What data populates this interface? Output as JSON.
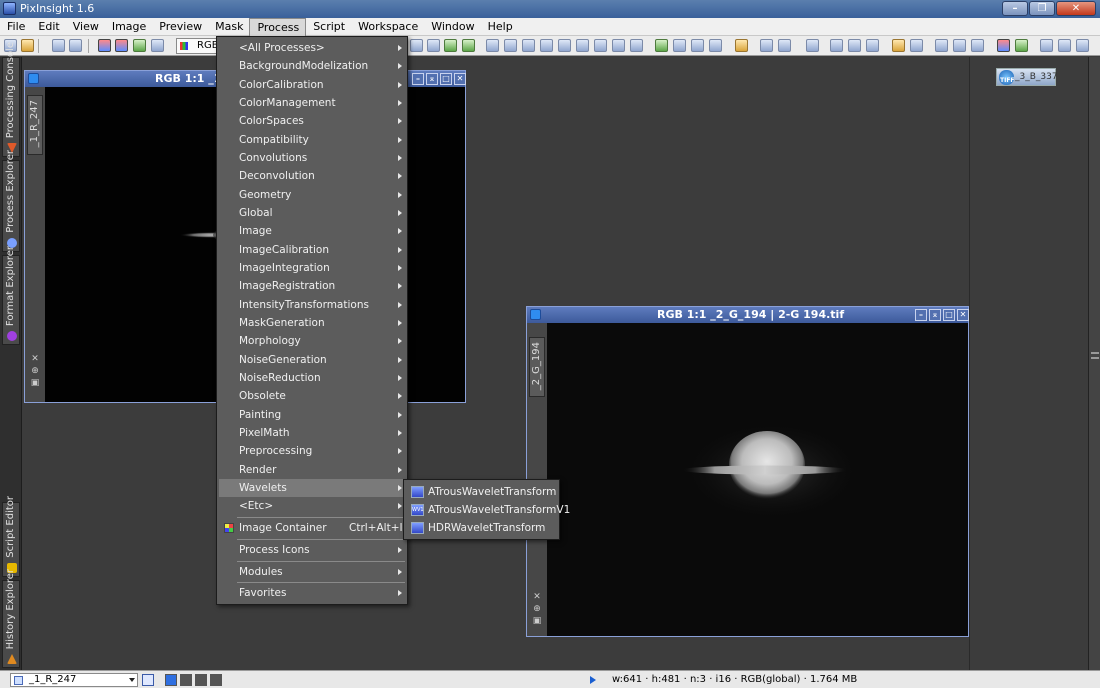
{
  "window": {
    "title": "PixInsight 1.6"
  },
  "menubar": [
    "File",
    "Edit",
    "View",
    "Image",
    "Preview",
    "Mask",
    "Process",
    "Script",
    "Workspace",
    "Window",
    "Help"
  ],
  "toolbar": {
    "rgb_label": "RGB"
  },
  "left_dock": [
    {
      "label": "Processing Console",
      "icon": "arrow-down-icon",
      "color": "#e05a2a"
    },
    {
      "label": "Process Explorer",
      "icon": "gear-icon",
      "color": "#7aa0ff"
    },
    {
      "label": "Format Explorer",
      "icon": "sphere-icon",
      "color": "#a040e0"
    },
    {
      "label": "Script Editor",
      "icon": "script-icon",
      "color": "#e6b800"
    },
    {
      "label": "History Explorer",
      "icon": "triangle-icon",
      "color": "#e08a20"
    }
  ],
  "desktop_icon": {
    "badge": "TIFF",
    "label": "_3_B_337"
  },
  "image_windows": [
    {
      "title": "RGB 1:1 _1",
      "vertical_tab": "_1_R_247"
    },
    {
      "title": "RGB 1:1 _2_G_194 | 2-G 194.tif",
      "vertical_tab": "_2_G_194"
    }
  ],
  "process_menu": {
    "items": [
      {
        "label": "<All Processes>",
        "submenu": true
      },
      {
        "label": "BackgroundModelization",
        "submenu": true
      },
      {
        "label": "ColorCalibration",
        "submenu": true
      },
      {
        "label": "ColorManagement",
        "submenu": true
      },
      {
        "label": "ColorSpaces",
        "submenu": true
      },
      {
        "label": "Compatibility",
        "submenu": true
      },
      {
        "label": "Convolutions",
        "submenu": true
      },
      {
        "label": "Deconvolution",
        "submenu": true
      },
      {
        "label": "Geometry",
        "submenu": true
      },
      {
        "label": "Global",
        "submenu": true
      },
      {
        "label": "Image",
        "submenu": true
      },
      {
        "label": "ImageCalibration",
        "submenu": true
      },
      {
        "label": "ImageIntegration",
        "submenu": true
      },
      {
        "label": "ImageRegistration",
        "submenu": true
      },
      {
        "label": "IntensityTransformations",
        "submenu": true
      },
      {
        "label": "MaskGeneration",
        "submenu": true
      },
      {
        "label": "Morphology",
        "submenu": true
      },
      {
        "label": "NoiseGeneration",
        "submenu": true
      },
      {
        "label": "NoiseReduction",
        "submenu": true
      },
      {
        "label": "Obsolete",
        "submenu": true
      },
      {
        "label": "Painting",
        "submenu": true
      },
      {
        "label": "PixelMath",
        "submenu": true
      },
      {
        "label": "Preprocessing",
        "submenu": true
      },
      {
        "label": "Render",
        "submenu": true
      },
      {
        "label": "Wavelets",
        "submenu": true,
        "highlighted": true
      },
      {
        "label": "<Etc>",
        "submenu": true
      }
    ],
    "image_container": {
      "label": "Image Container",
      "shortcut": "Ctrl+Alt+I"
    },
    "process_icons": {
      "label": "Process Icons"
    },
    "modules": {
      "label": "Modules"
    },
    "favorites": {
      "label": "Favorites"
    }
  },
  "wavelets_submenu": [
    {
      "label": "ATrousWaveletTransform",
      "icon": "wavelet-icon"
    },
    {
      "label": "ATrousWaveletTransformV1",
      "icon": "wavelet-v1-icon",
      "badge": "WV1"
    },
    {
      "label": "HDRWaveletTransform",
      "icon": "hdr-wavelet-icon"
    }
  ],
  "statusbar": {
    "view_selector": "_1_R_247",
    "info": "w:641 · h:481 · n:3 · i16 · RGB(global) · 1.764 MB"
  }
}
